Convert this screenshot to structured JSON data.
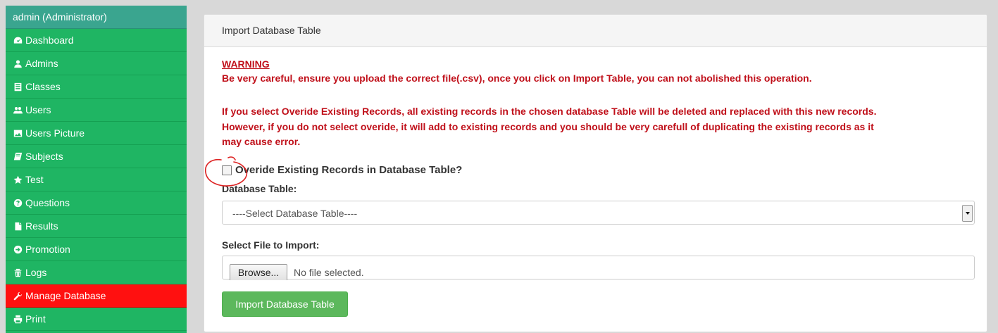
{
  "sidebar": {
    "header": "admin (Administrator)",
    "items": [
      {
        "label": "Dashboard",
        "icon": "dashboard-icon"
      },
      {
        "label": "Admins",
        "icon": "user-icon"
      },
      {
        "label": "Classes",
        "icon": "list-icon"
      },
      {
        "label": "Users",
        "icon": "users-icon"
      },
      {
        "label": "Users Picture",
        "icon": "picture-icon"
      },
      {
        "label": "Subjects",
        "icon": "book-icon"
      },
      {
        "label": "Test",
        "icon": "star-icon"
      },
      {
        "label": "Questions",
        "icon": "question-icon"
      },
      {
        "label": "Results",
        "icon": "file-icon"
      },
      {
        "label": "Promotion",
        "icon": "arrow-circle-icon"
      },
      {
        "label": "Logs",
        "icon": "trash-icon"
      },
      {
        "label": "Manage Database",
        "icon": "wrench-icon",
        "active": true
      },
      {
        "label": "Print",
        "icon": "print-icon"
      }
    ]
  },
  "panel": {
    "heading": "Import Database Table",
    "warning_title": "WARNING",
    "warning_line1": "Be very careful, ensure you upload the correct file(.csv), once you click on Import Table, you can not abolished this operation.",
    "warning_line2": "If you select Overide Existing Records, all existing records in the chosen database Table will be deleted and replaced with this new records.",
    "warning_line3": "However, if you do not select overide, it will add to existing records and you should be very carefull of duplicating the existing records as it",
    "warning_line4": "may cause error.",
    "checkbox_label": "Overide Existing Records in Database Table?",
    "db_table_label": "Database Table:",
    "db_table_value": "----Select Database Table----",
    "file_label": "Select File to Import:",
    "browse_label": "Browse...",
    "file_status": "No file selected.",
    "import_button": "Import Database Table"
  },
  "colors": {
    "sidebar_bg": "#1fb563",
    "sidebar_header": "#3aa58f",
    "active_item": "#ff1010",
    "warning_text": "#c0101a",
    "import_button": "#5cb85c"
  }
}
